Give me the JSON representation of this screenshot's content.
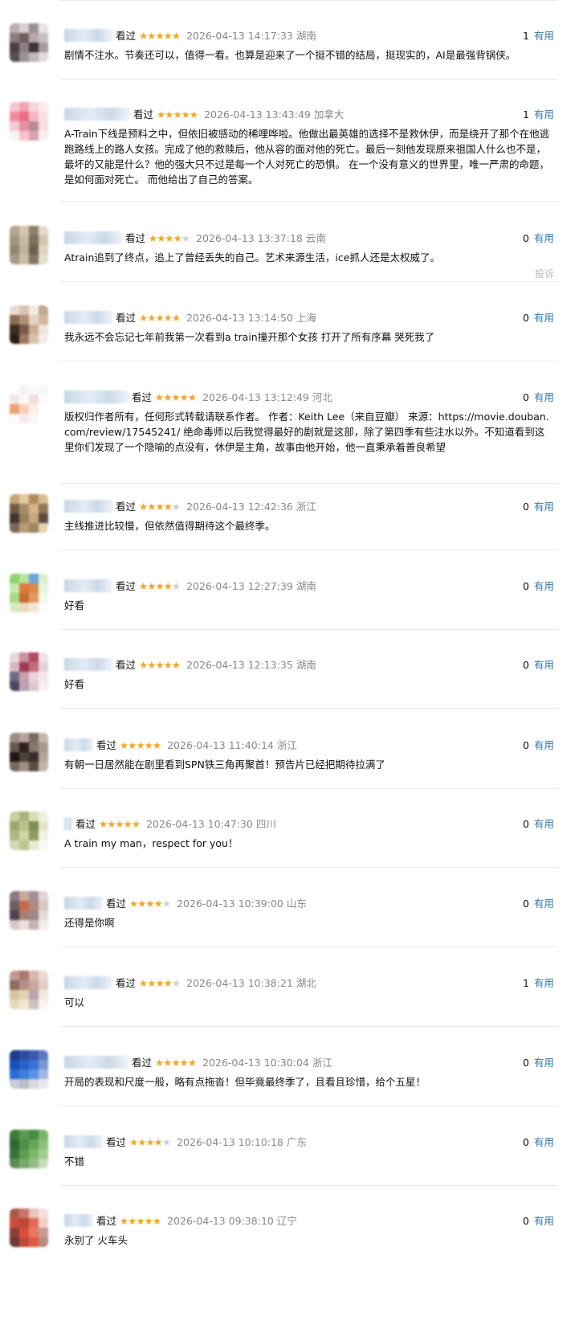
{
  "vote_label": "有用",
  "report_label": "投诉",
  "comments": [
    {
      "status": "看过",
      "rating": 5,
      "time": "2026-04-13 14:17:33",
      "location": "湖南",
      "votes": "1",
      "text": "剧情不注水。节奏还可以，值得一看。也算是迎来了一个挺不错的结局，挺现实的，AI是最强背锅侠。",
      "avatar_colors": [
        "#b8aeb0",
        "#d7d0d0",
        "#9a8f92",
        "#e8e4e4",
        "#8b7c80",
        "#6e5e60",
        "#b9a7a8",
        "#c9c0c2",
        "#4a3e40",
        "#8d8083",
        "#3d3234",
        "#a89a9b",
        "#5a5052",
        "#9c9294",
        "#c0b8b9",
        "#dedada"
      ]
    },
    {
      "status": "看过",
      "rating": 5,
      "time": "2026-04-13 13:43:49",
      "location": "加拿大",
      "votes": "1",
      "text": "A-Train下线是预料之中，但依旧被感动的稀哩哗啦。他做出最英雄的选择不是救休伊，而是绕开了那个在他逃跑路线上的路人女孩。完成了他的救赎后，他从容的面对他的死亡。最后一刻他发现原来祖国人什么也不是，最坏的又能是什么？他的强大只不过是每一个人对死亡的恐惧。 在一个没有意义的世界里，唯一严肃的命题，是如何面对死亡。 而他给出了自己的答案。",
      "avatar_colors": [
        "#f7c6cf",
        "#f2a3b3",
        "#f5d5db",
        "#fbe9ec",
        "#f08aa0",
        "#e86e88",
        "#f4b6c3",
        "#fae0e5",
        "#f7cbd3",
        "#e98fa3",
        "#b98a93",
        "#f9dde2",
        "#fdf3f5",
        "#f6c2cd",
        "#d7a7b1",
        "#fcecef"
      ]
    },
    {
      "status": "看过",
      "rating": 4,
      "time": "2026-04-13 13:37:18",
      "location": "云南",
      "votes": "0",
      "text": "Atrain追到了终点，追上了曾经丢失的自己。艺术来源生活，ice抓人还是太权威了。",
      "report": true,
      "avatar_colors": [
        "#b3a58f",
        "#d3c7b2",
        "#8f8068",
        "#e2d9c8",
        "#a39480",
        "#c6b9a2",
        "#7d6e58",
        "#cfc3ad",
        "#938570",
        "#bfb29b",
        "#6f604b",
        "#ddd3c1",
        "#a79a85",
        "#c9bda7",
        "#857763",
        "#e6dece"
      ]
    },
    {
      "status": "看过",
      "rating": 5,
      "time": "2026-04-13 13:14:50",
      "location": "上海",
      "votes": "0",
      "text": "我永远不会忘记七年前我第一次看到a train撞开那个女孩 打开了所有序幕 哭死我了",
      "avatar_colors": [
        "#e8dcd0",
        "#d9c4b0",
        "#f2ebe4",
        "#c6a98e",
        "#8a6a52",
        "#b08f74",
        "#e6d5c4",
        "#d2b79c",
        "#3c2c22",
        "#7a5a44",
        "#c8ad94",
        "#efe4da",
        "#2a1e18",
        "#9b7a60",
        "#d8c2ac",
        "#f5eee7"
      ]
    },
    {
      "status": "看过",
      "rating": 5,
      "time": "2026-04-13 13:12:49",
      "location": "河北",
      "votes": "0",
      "text": "版权归作者所有，任何形式转载请联系作者。 作者：Keith Lee（来自豆瓣） 来源：https://movie.douban.com/review/17545241/ 绝命毒师以后我觉得最好的剧就是这部，除了第四季有些注水以外。不知道看到这里你们发现了一个隐喻的点没有，休伊是主角，故事由他开始，他一直秉承着善良希望",
      "avatar_colors": [
        "#ffffff",
        "#f7f2f2",
        "#fbfafa",
        "#f9f4f4",
        "#f3e6e6",
        "#fbf7f7",
        "#f0dede",
        "#fdfbfb",
        "#f0a070",
        "#f6d0bc",
        "#fcefe8",
        "#ffffff",
        "#fdfaf9",
        "#f7ecec",
        "#fbf6f6",
        "#ffffff"
      ]
    },
    {
      "status": "看过",
      "rating": 4,
      "time": "2026-04-13 12:42:36",
      "location": "浙江",
      "votes": "0",
      "text": "主线推进比较慢，但依然值得期待这个最终季。",
      "avatar_colors": [
        "#c9a571",
        "#e0c89b",
        "#b08a5a",
        "#d8bd90",
        "#6e5a46",
        "#a98c66",
        "#d4b486",
        "#8e7458",
        "#3e3634",
        "#9a7e5e",
        "#c5a77c",
        "#5c4c40",
        "#7a6654",
        "#b89b74",
        "#a08660",
        "#e6d2ae"
      ]
    },
    {
      "status": "看过",
      "rating": 4,
      "time": "2026-04-13 12:27:39",
      "location": "湖南",
      "votes": "0",
      "text": "好看",
      "avatar_colors": [
        "#8fd16a",
        "#b6e39a",
        "#6fa3e0",
        "#d9efc9",
        "#c9e6b2",
        "#e07a3a",
        "#d8894c",
        "#e6f3dc",
        "#a7db86",
        "#c56a32",
        "#e09a5e",
        "#f1f8ec",
        "#d2ecbf",
        "#ecd8bc",
        "#f3e6d6",
        "#fbfdf9"
      ]
    },
    {
      "status": "看过",
      "rating": 5,
      "time": "2026-04-13 12:13:35",
      "location": "湖南",
      "votes": "0",
      "text": "好看",
      "avatar_colors": [
        "#e8d8dc",
        "#c9929e",
        "#b5485e",
        "#efe2e6",
        "#d7b7bf",
        "#9e3b50",
        "#c46a7e",
        "#e5cfd5",
        "#6e6a86",
        "#c7a0aa",
        "#e9d3d9",
        "#f3e9ec",
        "#4a4660",
        "#b8a2b0",
        "#dcc8ce",
        "#f6eef0"
      ]
    },
    {
      "status": "看过",
      "rating": 5,
      "time": "2026-04-13 11:40:14",
      "location": "浙江",
      "votes": "0",
      "text": "有朝一日居然能在剧里看到SPN铁三角再聚首！预告片已经把期待拉满了",
      "avatar_colors": [
        "#9e8a80",
        "#b8a49a",
        "#7d6a62",
        "#c7b6ac",
        "#6a5850",
        "#2c2220",
        "#8a7870",
        "#a89890",
        "#1e1614",
        "#4e3e38",
        "#3a2c28",
        "#b4a29a",
        "#7a6860",
        "#a08e86",
        "#5e4c46",
        "#c4b2aa"
      ]
    },
    {
      "status": "看过",
      "rating": 5,
      "time": "2026-04-13 10:47:30",
      "location": "四川",
      "votes": "0",
      "text": "A train my man，respect for you！",
      "avatar_colors": [
        "#c9cfa0",
        "#a8b47a",
        "#d9ddb8",
        "#eef0dd",
        "#9aa86a",
        "#b9c28c",
        "#7c8e52",
        "#e2e6c8",
        "#adb884",
        "#cfd5a8",
        "#8e9e62",
        "#f1f3e4",
        "#d4d9b0",
        "#bcc592",
        "#e8ebd2",
        "#f7f8ee"
      ]
    },
    {
      "status": "看过",
      "rating": 4,
      "time": "2026-04-13 10:39:00",
      "location": "山东",
      "votes": "0",
      "text": "还得是你啊",
      "avatar_colors": [
        "#8a7a86",
        "#c9a898",
        "#a48e96",
        "#e2d4d0",
        "#6e5e6a",
        "#c46a4a",
        "#b0887c",
        "#d7c6c2",
        "#4e4250",
        "#a6806e",
        "#9a8a90",
        "#e6dad6",
        "#d6c8c6",
        "#eadfdb",
        "#c2b2b4",
        "#f3ecea"
      ]
    },
    {
      "status": "看过",
      "rating": 4,
      "time": "2026-04-13 10:38:21",
      "location": "湖北",
      "votes": "1",
      "text": "可以",
      "avatar_colors": [
        "#c49a8e",
        "#a8786e",
        "#d8b8ae",
        "#ead8d2",
        "#8e6a64",
        "#b49088",
        "#c8a89c",
        "#e2ccc4",
        "#d8c4a0",
        "#e6d2b0",
        "#b8a4a8",
        "#f0e6de",
        "#e8d8b8",
        "#f2e6cc",
        "#cec0c4",
        "#f8f2ec"
      ]
    },
    {
      "status": "看过",
      "rating": 5,
      "time": "2026-04-13 10:30:04",
      "location": "浙江",
      "votes": "0",
      "text": "开局的表现和尺度一般，略有点拖沓！但毕竟最终季了，且看且珍惜，给个五星！",
      "avatar_colors": [
        "#1e3a8a",
        "#2c4a9e",
        "#3a5ab0",
        "#5a78c2",
        "#1a4fb8",
        "#2a60c8",
        "#3b72d6",
        "#7a96d0",
        "#2a6ad8",
        "#3e80e0",
        "#5a94e6",
        "#a0b6e0",
        "#c8ccd6",
        "#b8bcc6",
        "#d6d8de",
        "#e6e8ec"
      ]
    },
    {
      "status": "看过",
      "rating": 4,
      "time": "2026-04-13 10:10:18",
      "location": "广东",
      "votes": "0",
      "text": "不错",
      "avatar_colors": [
        "#3e7a3a",
        "#5a9a4e",
        "#4a8a44",
        "#7ab26a",
        "#2e6a30",
        "#4e8e46",
        "#68a458",
        "#8cc07a",
        "#36743a",
        "#5e9c50",
        "#7cb86a",
        "#a2cc92",
        "#5a8e52",
        "#76a866",
        "#92bc82",
        "#c4dcb8"
      ]
    },
    {
      "status": "看过",
      "rating": 5,
      "time": "2026-04-13 09:38:10",
      "location": "辽宁",
      "votes": "0",
      "text": "永别了 火车头",
      "avatar_colors": [
        "#a85a4a",
        "#c8786a",
        "#e8c4bc",
        "#f4e0dc",
        "#d04a3a",
        "#b8483a",
        "#e06a58",
        "#f0d0c8",
        "#8a3e34",
        "#d8503c",
        "#e8785e",
        "#c89a8e",
        "#6a3a34",
        "#c04838",
        "#e05a44",
        "#b88a80"
      ]
    }
  ]
}
